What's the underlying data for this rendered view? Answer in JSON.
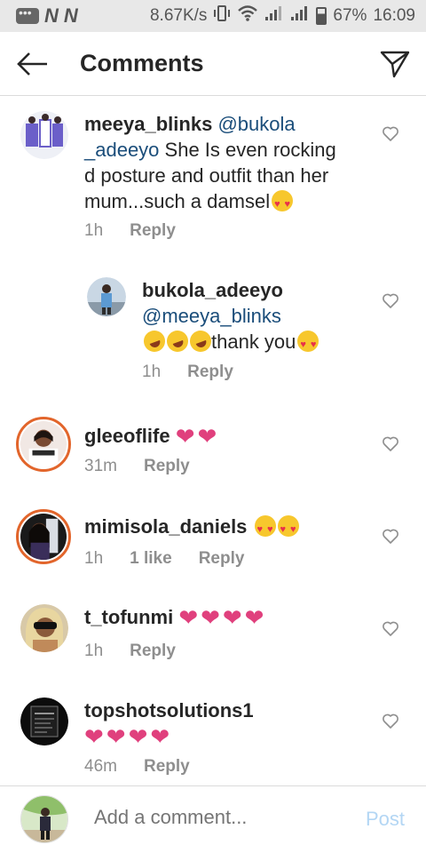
{
  "status_bar": {
    "network_a": "N",
    "network_b": "N",
    "speed": "8.67K/s",
    "battery": "67%",
    "time": "16:09"
  },
  "header": {
    "title": "Comments"
  },
  "comments": [
    {
      "username": "meeya_blinks",
      "mention": "@bukola_adeeyo",
      "mention_line1": "@bukola",
      "mention_line2": "_adeeyo",
      "text_part1": " She Is even rocking",
      "text_part2": "d posture and outfit than her",
      "text_part3": "mum...such a damsel",
      "time": "1h",
      "reply_label": "Reply"
    },
    {
      "username": "bukola_adeeyo",
      "mention": "@meeya_blinks",
      "text": "thank you",
      "time": "1h",
      "reply_label": "Reply"
    },
    {
      "username": "gleeoflife",
      "time": "31m",
      "reply_label": "Reply"
    },
    {
      "username": "mimisola_daniels",
      "time": "1h",
      "likes": "1 like",
      "reply_label": "Reply"
    },
    {
      "username": "t_tofunmi",
      "time": "1h",
      "reply_label": "Reply"
    },
    {
      "username": "topshotsolutions1",
      "time": "46m",
      "reply_label": "Reply"
    }
  ],
  "add_comment": {
    "placeholder": "Add a comment...",
    "post_label": "Post"
  },
  "colors": {
    "mention": "#1a4d7a",
    "heart": "#e0407d",
    "story_ring": "#e2652b",
    "post_disabled": "#b3d6f4"
  }
}
